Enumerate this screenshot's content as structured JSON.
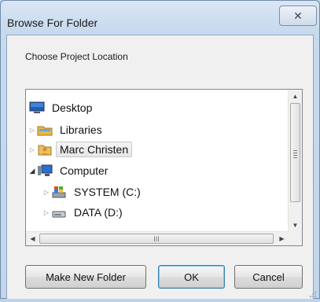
{
  "window": {
    "title": "Browse For Folder",
    "close_glyph": "✕"
  },
  "prompt": "Choose Project Location",
  "tree": {
    "items": [
      {
        "label": "Desktop",
        "icon": "desktop-icon",
        "expander": "",
        "selected": false
      },
      {
        "label": "Libraries",
        "icon": "libraries-icon",
        "expander": "▷",
        "selected": false
      },
      {
        "label": "Marc Christen",
        "icon": "user-folder-icon",
        "expander": "▷",
        "selected": true
      },
      {
        "label": "Computer",
        "icon": "computer-icon",
        "expander": "◢",
        "selected": false
      },
      {
        "label": "SYSTEM (C:)",
        "icon": "system-drive-icon",
        "expander": "▷",
        "selected": false
      },
      {
        "label": "DATA (D:)",
        "icon": "drive-icon",
        "expander": "▷",
        "selected": false
      }
    ],
    "scroll": {
      "up": "▲",
      "down": "▼",
      "left": "◀",
      "right": "▶",
      "hgrip": "III"
    }
  },
  "buttons": {
    "new_folder": "Make New Folder",
    "ok": "OK",
    "cancel": "Cancel"
  },
  "colors": {
    "title_bar": "#c7d9ee",
    "selection": "#e6e6e6",
    "default_button_border": "#3c7fb1"
  }
}
